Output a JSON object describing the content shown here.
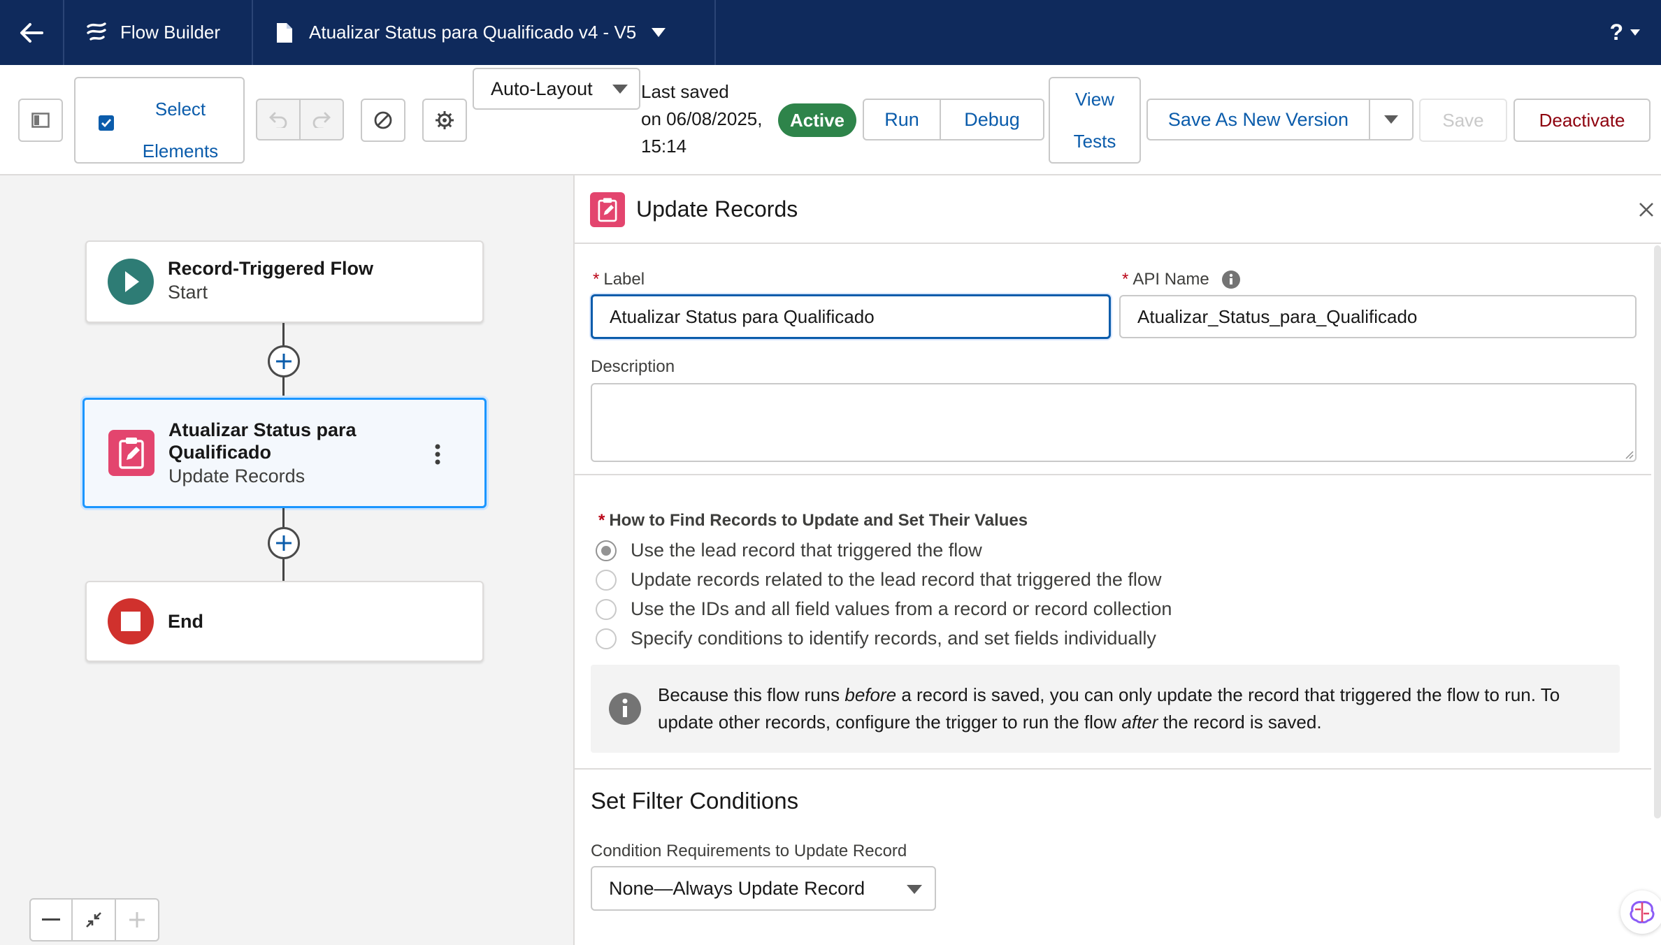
{
  "header": {
    "app_name": "Flow Builder",
    "flow_name": "Atualizar Status para Qualificado v4 - V5",
    "help_label": "?"
  },
  "toolbar": {
    "select_elements_line1": "Select",
    "select_elements_line2": "Elements",
    "layout_mode": "Auto-Layout",
    "last_saved_line1": "Last saved",
    "last_saved_line2": "on 06/08/2025,",
    "last_saved_line3": "15:14",
    "status_badge": "Active",
    "run_label": "Run",
    "debug_label": "Debug",
    "view_tests_line1": "View",
    "view_tests_line2": "Tests",
    "save_as_new_version_label": "Save As New Version",
    "save_label": "Save",
    "deactivate_label": "Deactivate"
  },
  "canvas": {
    "start_node": {
      "title": "Record-Triggered Flow",
      "subtitle": "Start"
    },
    "update_node": {
      "title": "Atualizar Status para Qualificado",
      "subtitle": "Update Records"
    },
    "end_node": {
      "title": "End"
    }
  },
  "panel": {
    "title": "Update Records",
    "label_field": {
      "label": "Label",
      "value": "Atualizar Status para Qualificado"
    },
    "api_name_field": {
      "label": "API Name",
      "value": "Atualizar_Status_para_Qualificado"
    },
    "description_label": "Description",
    "find_records_title": "How to Find Records to Update and Set Their Values",
    "options": [
      "Use the lead record that triggered the flow",
      "Update records related to the lead record that triggered the flow",
      "Use the IDs and all field values from a record or record collection",
      "Specify conditions to identify records, and set fields individually"
    ],
    "info": {
      "part1": "Because this flow runs ",
      "em1": "before",
      "part2": " a record is saved, you can only update the record that triggered the flow to run. To update other records, configure the trigger to run the flow ",
      "em2": "after",
      "part3": " the record is saved."
    },
    "filter_title": "Set Filter Conditions",
    "condition_label": "Condition Requirements to Update Record",
    "condition_value": "None—Always Update Record"
  },
  "colors": {
    "header_bg": "#0f2a5c",
    "brand_blue": "#0b5cab",
    "active_green": "#2e844a",
    "deactivate_red": "#8e030f",
    "update_icon_pink": "#e3456e",
    "start_icon_teal": "#2e7c75",
    "end_icon_red": "#d0312d"
  },
  "icons": [
    "back-arrow-icon",
    "flow-builder-icon",
    "document-icon",
    "chevron-down-icon",
    "help-icon",
    "toggle-panel-icon",
    "select-checkbox-icon",
    "undo-icon",
    "redo-icon",
    "error-check-icon",
    "gear-icon",
    "play-icon",
    "update-records-icon",
    "stop-icon",
    "add-icon",
    "more-actions-icon",
    "info-icon",
    "close-icon",
    "zoom-out-icon",
    "fit-view-icon",
    "zoom-in-icon",
    "ai-assistant-icon"
  ]
}
